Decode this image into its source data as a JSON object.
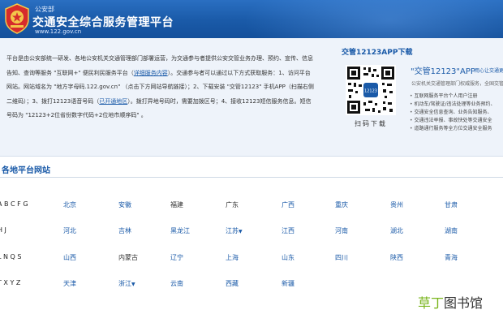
{
  "header": {
    "ministry": "公安部",
    "title": "交通安全综合服务管理平台",
    "url": "www.122.gov.cn"
  },
  "intro": {
    "part1": "平台是由公安部统一研发、各地公安机关交通管理部门部署运营，为交通参与者提供公安交管业务办理、预约、宣传、信息告知、查询等服务 \"互联网+\" 便民利民服务平台（",
    "link1": "详细服务内容",
    "part2": "）。交通参与者可以通过以下方式获取服务：1、访问平台网站。网站域名为 \"地方字母码.122.gov.cn\" （点击下方网站导航链接）；2、下载安装 \"交管12123\" 手机APP（扫描右侧二维码）；3、拨打12123语音号码（",
    "link2": "已开通地区",
    "part3": "）。拨打异地号码时，需要加拨区号；4、接收12123短信服务信息。短信号码为 \"12123+2位省份数字代码+2位地市顺序码\" 。"
  },
  "app": {
    "download_title": "交管12123APP下载",
    "qr_caption": "扫码下载",
    "name": "\"交管12123\"APP",
    "tag": "用心让交通更",
    "subtitle": "公安机关交通管理部门权威服务，全国交管业务办",
    "features": [
      "互联网服务平台个人用户注册",
      "机动车/驾驶证/违法处理等业务预约、",
      "交通安全信息查询、业务告知服务、",
      "交通违法举报、事故快处等交通安全",
      "道路通行服务等全方位交通安全服务"
    ]
  },
  "section": {
    "title": "各地平台网站"
  },
  "rows": [
    {
      "letters": "A B C F G",
      "items": [
        {
          "name": "北京",
          "link": true,
          "caret": false
        },
        {
          "name": "安徽",
          "link": true,
          "caret": false
        },
        {
          "name": "福建",
          "link": false,
          "caret": false
        },
        {
          "name": "广东",
          "link": false,
          "caret": false
        },
        {
          "name": "广西",
          "link": true,
          "caret": false
        },
        {
          "name": "重庆",
          "link": true,
          "caret": false
        },
        {
          "name": "贵州",
          "link": true,
          "caret": false
        },
        {
          "name": "甘肃",
          "link": true,
          "caret": false
        }
      ]
    },
    {
      "letters": "H J",
      "items": [
        {
          "name": "河北",
          "link": true,
          "caret": false
        },
        {
          "name": "吉林",
          "link": true,
          "caret": false
        },
        {
          "name": "黑龙江",
          "link": true,
          "caret": false
        },
        {
          "name": "江苏",
          "link": true,
          "caret": true
        },
        {
          "name": "江西",
          "link": true,
          "caret": false
        },
        {
          "name": "河南",
          "link": true,
          "caret": false
        },
        {
          "name": "湖北",
          "link": true,
          "caret": false
        },
        {
          "name": "湖南",
          "link": true,
          "caret": false
        }
      ]
    },
    {
      "letters": "L N Q S",
      "items": [
        {
          "name": "山西",
          "link": true,
          "caret": false
        },
        {
          "name": "内蒙古",
          "link": false,
          "caret": false
        },
        {
          "name": "辽宁",
          "link": true,
          "caret": false
        },
        {
          "name": "上海",
          "link": true,
          "caret": false
        },
        {
          "name": "山东",
          "link": true,
          "caret": false
        },
        {
          "name": "四川",
          "link": true,
          "caret": false
        },
        {
          "name": "陕西",
          "link": true,
          "caret": false
        },
        {
          "name": "青海",
          "link": true,
          "caret": false
        }
      ]
    },
    {
      "letters": "T X Y Z",
      "items": [
        {
          "name": "天津",
          "link": true,
          "caret": false
        },
        {
          "name": "浙江",
          "link": true,
          "caret": true
        },
        {
          "name": "云南",
          "link": true,
          "caret": false
        },
        {
          "name": "西藏",
          "link": true,
          "caret": false
        },
        {
          "name": "新疆",
          "link": true,
          "caret": false
        }
      ]
    }
  ],
  "watermark": {
    "green": "草丁",
    "dark": "图书馆"
  },
  "colors": {
    "header_blue": "#1a5aa8",
    "link_blue": "#1a5aa8",
    "band_bg": "#eef3fa",
    "watermark_green": "#7ab51d"
  }
}
